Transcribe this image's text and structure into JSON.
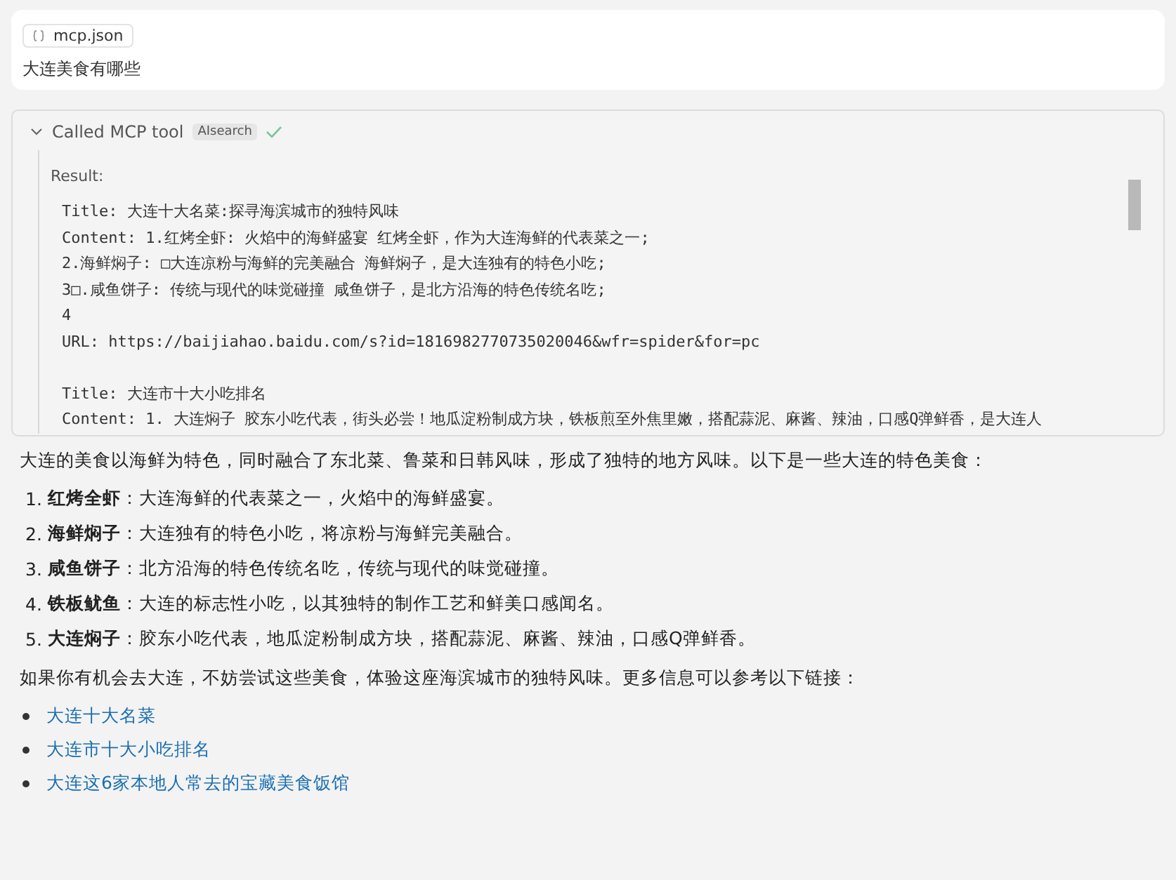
{
  "prompt_card": {
    "attachment": "mcp.json",
    "question": "大连美食有哪些"
  },
  "tool_call": {
    "label": "Called MCP tool",
    "tool": "AIsearch",
    "expanded": true,
    "result_label": "Result:",
    "results": [
      {
        "lines": [
          "Title: 大连十大名菜:探寻海滨城市的独特风味",
          "Content: 1.红烤全虾: 火焰中的海鲜盛宴 红烤全虾，作为大连海鲜的代表菜之一;",
          "2.海鲜焖子: □大连凉粉与海鲜的完美融合 海鲜焖子，是大连独有的特色小吃;",
          "3□.咸鱼饼子: 传统与现代的味觉碰撞 咸鱼饼子，是北方沿海的特色传统名吃;",
          "4",
          "URL: https://baijiahao.baidu.com/s?id=1816982770735020046&wfr=spider&for=pc"
        ]
      },
      {
        "lines": [
          "Title: 大连市十大小吃排名",
          "Content: 1. 大连焖子 胶东小吃代表，街头必尝！地瓜淀粉制成方块，铁板煎至外焦里嫩，搭配蒜泥、麻酱、辣油，口感Q弹鲜香，是大连人"
        ]
      }
    ]
  },
  "answer": {
    "intro": "大连的美食以海鲜为特色，同时融合了东北菜、鲁菜和日韩风味，形成了独特的地方风味。以下是一些大连的特色美食：",
    "dishes": [
      {
        "number": "1.",
        "name": "红烤全虾",
        "text": "：大连海鲜的代表菜之一，火焰中的海鲜盛宴。"
      },
      {
        "number": "2.",
        "name": "海鲜焖子",
        "text": "：大连独有的特色小吃，将凉粉与海鲜完美融合。"
      },
      {
        "number": "3.",
        "name": "咸鱼饼子",
        "text": "：北方沿海的特色传统名吃，传统与现代的味觉碰撞。"
      },
      {
        "number": "4.",
        "name": "铁板鱿鱼",
        "text": "：大连的标志性小吃，以其独特的制作工艺和鲜美口感闻名。"
      },
      {
        "number": "5.",
        "name": "大连焖子",
        "text": "：胶东小吃代表，地瓜淀粉制成方块，搭配蒜泥、麻酱、辣油，口感Q弹鲜香。"
      }
    ],
    "outro": "如果你有机会去大连，不妨尝试这些美食，体验这座海滨城市的独特风味。更多信息可以参考以下链接：",
    "links": [
      "大连十大名菜",
      "大连市十大小吃排名",
      "大连这6家本地人常去的宝藏美食饭馆"
    ]
  }
}
